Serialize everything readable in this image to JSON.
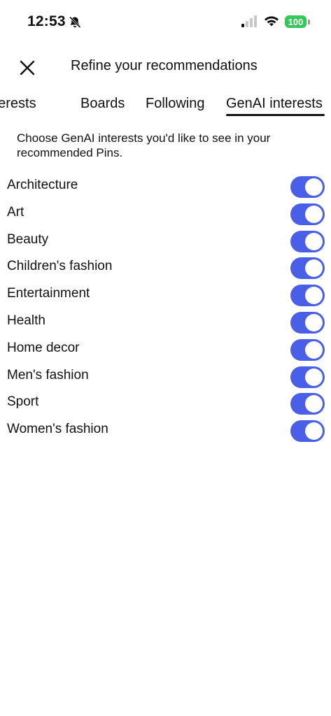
{
  "status_bar": {
    "time": "12:53",
    "battery_level": "100",
    "icons": [
      "bell-slash-icon",
      "signal-icon",
      "wifi-icon",
      "battery-icon"
    ],
    "battery_color": "#34c759"
  },
  "header": {
    "title": "Refine your recommendations",
    "close_icon": "close-icon"
  },
  "tabs": [
    {
      "label": "Interests",
      "visible_text": "ıterests",
      "selected": false
    },
    {
      "label": "Boards",
      "visible_text": "Boards",
      "selected": false
    },
    {
      "label": "Following",
      "visible_text": "Following",
      "selected": false
    },
    {
      "label": "GenAI interests",
      "visible_text": "GenAI interests",
      "selected": true
    }
  ],
  "description": "Choose GenAI interests you'd like to see in your recommended Pins.",
  "interests": [
    {
      "label": "Architecture",
      "enabled": true
    },
    {
      "label": "Art",
      "enabled": true
    },
    {
      "label": "Beauty",
      "enabled": true
    },
    {
      "label": "Children's fashion",
      "enabled": true
    },
    {
      "label": "Entertainment",
      "enabled": true
    },
    {
      "label": "Health",
      "enabled": true
    },
    {
      "label": "Home decor",
      "enabled": true
    },
    {
      "label": "Men's fashion",
      "enabled": true
    },
    {
      "label": "Sport",
      "enabled": true
    },
    {
      "label": "Women's fashion",
      "enabled": true
    }
  ],
  "colors": {
    "toggle_on": "#4a5fe8",
    "text": "#111111",
    "background": "#ffffff"
  }
}
